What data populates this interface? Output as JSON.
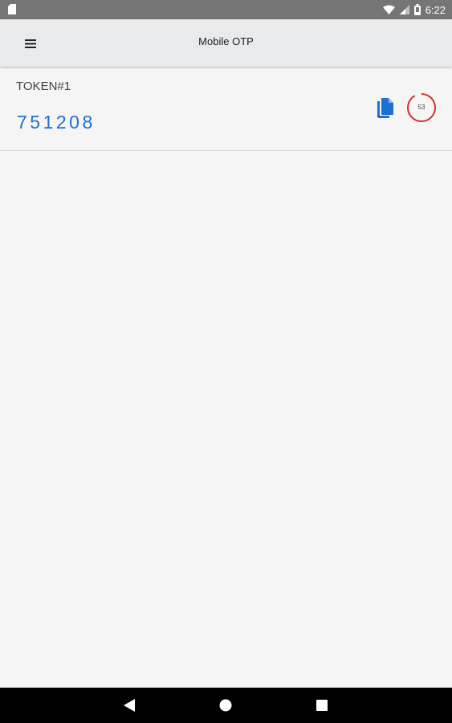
{
  "status_bar": {
    "time": "6:22",
    "icons": [
      "sd-card-icon",
      "wifi-icon",
      "signal-icon",
      "battery-icon"
    ]
  },
  "app_bar": {
    "title": "Mobile OTP",
    "menu_icon": "hamburger-menu-icon"
  },
  "tokens": [
    {
      "name": "TOKEN#1",
      "code": "751208",
      "seconds_remaining": "53",
      "copy_icon": "copy-icon"
    }
  ],
  "nav_bar": {
    "icons": [
      "back-icon",
      "home-icon",
      "recents-icon"
    ]
  },
  "colors": {
    "status_bar": "#757575",
    "app_bar": "#e9eaec",
    "background": "#f5f5f5",
    "code": "#1e6fd0",
    "timer_ring": "#d32f2f",
    "nav_bar": "#000000"
  }
}
